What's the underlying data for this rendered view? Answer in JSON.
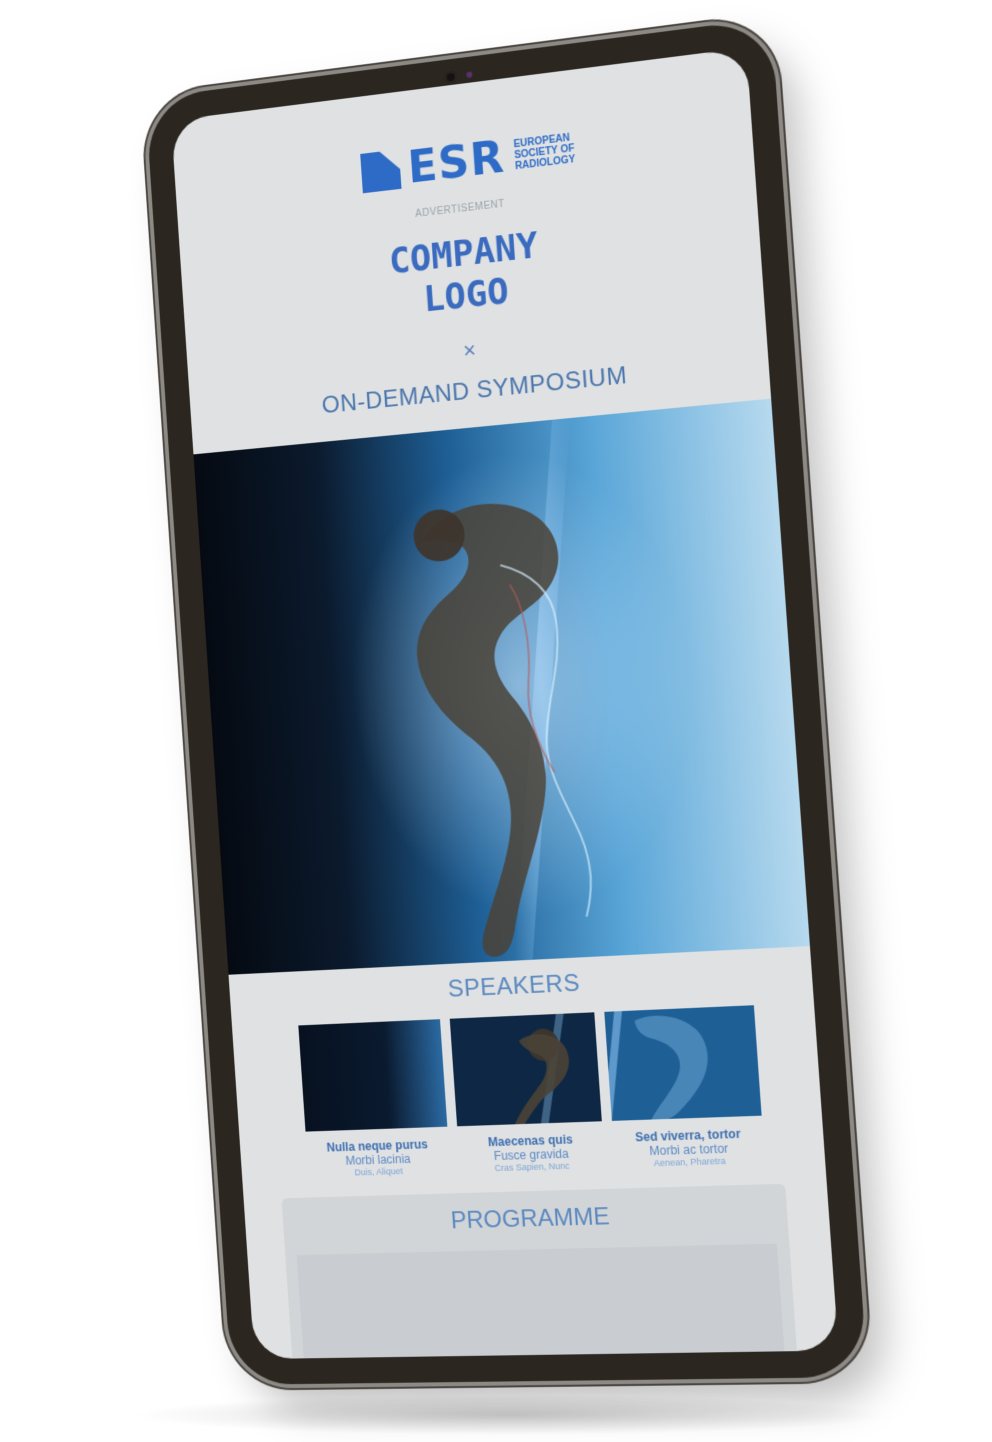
{
  "logo": {
    "mark": "ESR",
    "sub_line1": "EUROPEAN",
    "sub_line2": "SOCIETY OF",
    "sub_line3": "RADIOLOGY"
  },
  "labels": {
    "advertisement": "ADVERTISEMENT",
    "company_line1": "COMPANY",
    "company_line2": "LOGO",
    "times": "×",
    "ondemand": "ON-DEMAND SYMPOSIUM",
    "speakers": "SPEAKERS",
    "programme": "PROGRAMME"
  },
  "speakers": [
    {
      "name": "Nulla neque purus",
      "role": "Morbi lacinia",
      "org": "Duis, Aliquet"
    },
    {
      "name": "Maecenas quis",
      "role": "Fusce gravida",
      "org": "Cras Sapien, Nunc"
    },
    {
      "name": "Sed viverra, tortor",
      "role": "Morbi ac tortor",
      "org": "Aenean, Pharetra"
    }
  ],
  "icons": {
    "camera": "camera-icon"
  },
  "colors": {
    "brand_blue": "#2e6bc7",
    "screen_bg": "#dfe1e2",
    "bezel": "#2c2620"
  }
}
